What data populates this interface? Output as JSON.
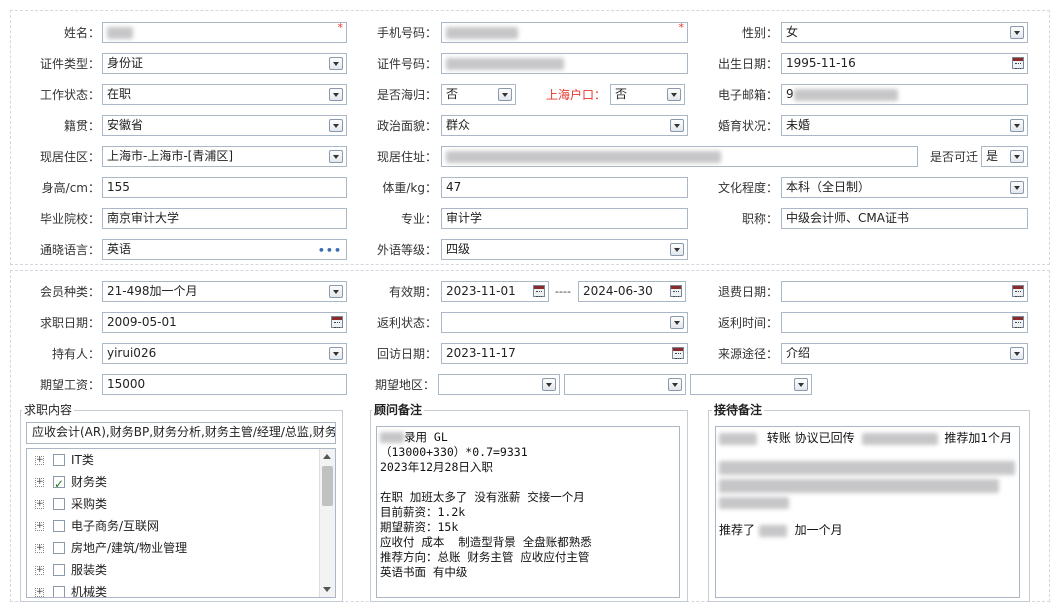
{
  "basic": {
    "name": {
      "label": "姓名：",
      "value": ""
    },
    "phone": {
      "label": "手机号码：",
      "value": ""
    },
    "gender": {
      "label": "性别：",
      "value": "女"
    },
    "id_type": {
      "label": "证件类型：",
      "value": "身份证"
    },
    "id_number": {
      "label": "证件号码：",
      "value": ""
    },
    "birth_date": {
      "label": "出生日期：",
      "value": "1995-11-16"
    },
    "work_status": {
      "label": "工作状态：",
      "value": "在职"
    },
    "overseas_return": {
      "label": "是否海归：",
      "value": "否"
    },
    "shanghai_hukou": {
      "label": "上海户口：",
      "value": "否"
    },
    "email": {
      "label": "电子邮箱：",
      "value": "9"
    },
    "native_place": {
      "label": "籍贯：",
      "value": "安徽省"
    },
    "political": {
      "label": "政治面貌：",
      "value": "群众"
    },
    "marital": {
      "label": "婚育状况：",
      "value": "未婚"
    },
    "residence": {
      "label": "现居住区：",
      "value": "上海市-上海市-[青浦区]"
    },
    "address": {
      "label": "现居住址：",
      "value": ""
    },
    "can_visit": {
      "label": "是否可迁",
      "value": "是"
    },
    "height": {
      "label": "身高/cm：",
      "value": "155"
    },
    "weight": {
      "label": "体重/kg：",
      "value": "47"
    },
    "education": {
      "label": "文化程度：",
      "value": "本科（全日制）"
    },
    "school": {
      "label": "毕业院校：",
      "value": "南京审计大学"
    },
    "major": {
      "label": "专业：",
      "value": "审计学"
    },
    "title": {
      "label": "职称：",
      "value": "中级会计师、CMA证书"
    },
    "languages": {
      "label": "通晓语言：",
      "value": "英语"
    },
    "foreign_level": {
      "label": "外语等级：",
      "value": "四级"
    }
  },
  "membership": {
    "member_type": {
      "label": "会员种类：",
      "value": "21-498加一个月"
    },
    "validity": {
      "label": "有效期：",
      "from": "2023-11-01",
      "sep": "----",
      "to": "2024-06-30"
    },
    "refund_date": {
      "label": "退费日期：",
      "value": ""
    },
    "job_date": {
      "label": "求职日期：",
      "value": "2009-05-01"
    },
    "rebate_status": {
      "label": "返利状态：",
      "value": ""
    },
    "rebate_time": {
      "label": "返利时间：",
      "value": ""
    },
    "holder": {
      "label": "持有人：",
      "value": "yirui026"
    },
    "revisit_date": {
      "label": "回访日期：",
      "value": "2023-11-17"
    },
    "source": {
      "label": "来源途径：",
      "value": "介绍"
    },
    "expected_salary": {
      "label": "期望工资：",
      "value": "15000"
    },
    "expected_area": {
      "label": "期望地区：",
      "values": [
        "",
        "",
        ""
      ]
    }
  },
  "job_panel": {
    "title": "求职内容",
    "summary": "应收会计(AR),财务BP,财务分析,财务主管/经理/总监,财务",
    "items": [
      {
        "label": "IT类",
        "checked": false
      },
      {
        "label": "财务类",
        "checked": true
      },
      {
        "label": "采购类",
        "checked": false
      },
      {
        "label": "电子商务/互联网",
        "checked": false
      },
      {
        "label": "房地产/建筑/物业管理",
        "checked": false
      },
      {
        "label": "服装类",
        "checked": false
      },
      {
        "label": "机械类",
        "checked": false
      }
    ]
  },
  "consultant_panel": {
    "title": "顾问备注",
    "line1_suffix": "录用 GL",
    "lines": [
      "（13000+330）*0.7=9331",
      "2023年12月28日入职",
      "",
      "在职 加班太多了 没有涨薪 交接一个月",
      "目前薪资：1.2k",
      "期望薪资：15k",
      "应收付 成本  制造型背景 全盘账都熟悉",
      "推荐方向：总账 财务主管 应收应付主管",
      "英语书面 有中级"
    ]
  },
  "reception_panel": {
    "title": "接待备注",
    "line1_mid": "转账 协议已回传",
    "line1_end": "推荐加1个月",
    "recommend_prefix": "推荐了",
    "recommend_suffix": "加一个月"
  }
}
